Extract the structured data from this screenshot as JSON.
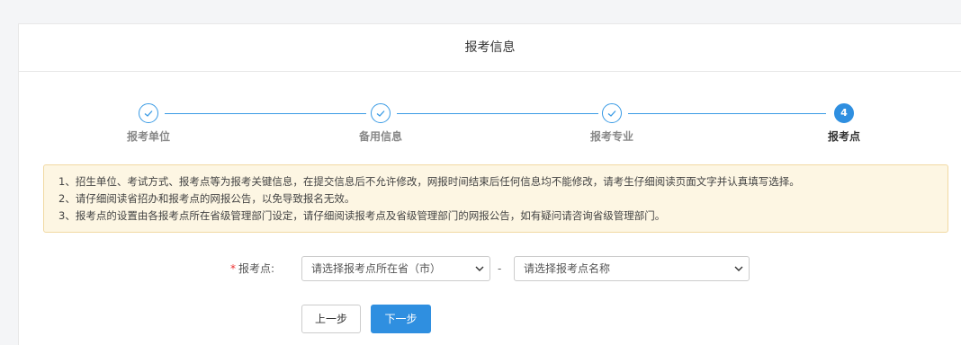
{
  "header": {
    "title": "报考信息"
  },
  "steps": [
    {
      "label": "报考单位",
      "state": "done",
      "icon": "check-icon"
    },
    {
      "label": "备用信息",
      "state": "done",
      "icon": "check-icon"
    },
    {
      "label": "报考专业",
      "state": "done",
      "icon": "check-icon"
    },
    {
      "label": "报考点",
      "state": "active",
      "number": "4"
    }
  ],
  "notice": {
    "lines": [
      "1、招生单位、考试方式、报考点等为报考关键信息，在提交信息后不允许修改，网报时间结束后任何信息均不能修改，请考生仔细阅读页面文字并认真填写选择。",
      "2、请仔细阅读省招办和报考点的网报公告，以免导致报名无效。",
      "3、报考点的设置由各报考点所在省级管理部门设定，请仔细阅读报考点及省级管理部门的网报公告，如有疑问请咨询省级管理部门。"
    ]
  },
  "form": {
    "required_mark": "*",
    "label": "报考点:",
    "province_select": "请选择报考点所在省（市）",
    "separator": "-",
    "site_select": "请选择报考点名称"
  },
  "buttons": {
    "prev": "上一步",
    "next": "下一步"
  },
  "colors": {
    "accent": "#2f8fe0",
    "notice_bg": "#fdf6e3",
    "required": "#e33333"
  }
}
